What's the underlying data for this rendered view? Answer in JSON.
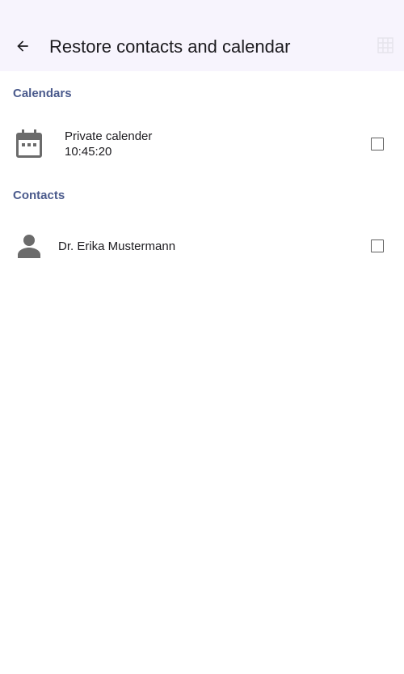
{
  "appbar": {
    "title": "Restore contacts and calendar",
    "back_icon": "arrow-back-icon",
    "menu_icon": "grid-icon"
  },
  "sections": {
    "calendars": {
      "label": "Calendars",
      "items": [
        {
          "icon": "calendar-icon",
          "name": "Private calender",
          "time": "10:45:20",
          "checked": false
        }
      ]
    },
    "contacts": {
      "label": "Contacts",
      "items": [
        {
          "icon": "person-icon",
          "name": "Dr. Erika Mustermann",
          "checked": false
        }
      ]
    }
  },
  "colors": {
    "appbar_bg": "#f7f4fd",
    "section_header": "#4a5a8c",
    "icon_gray": "#6b6b6b"
  }
}
